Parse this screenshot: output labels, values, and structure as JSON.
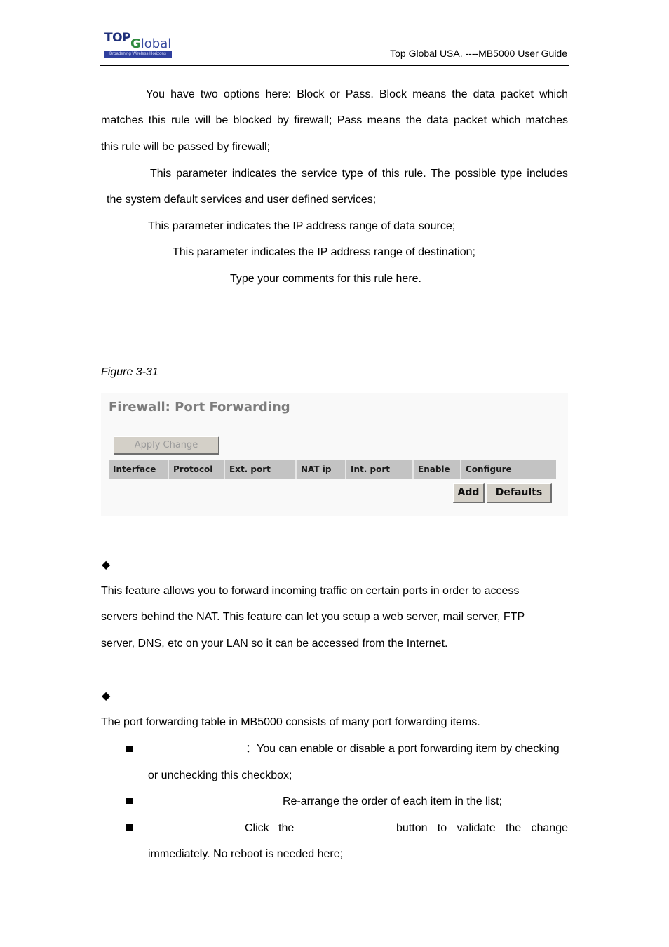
{
  "header": {
    "logo": {
      "top_text": "TOP",
      "global_g": "G",
      "global_rest": "lobal",
      "tagline": "Broadening Wireless Horizons"
    },
    "title": "Top Global USA. ----MB5000 User Guide"
  },
  "intro": {
    "action_line1": "You have two options here: Block or Pass. Block means the data packet which",
    "action_line2": "matches this rule will be blocked by firewall; Pass means the data packet which matches",
    "action_line3": "this rule will be passed by firewall;",
    "service_line1": "This parameter indicates the service type of this rule. The possible type includes",
    "service_line2": "the system default services and user defined services;",
    "source_line": "This parameter indicates the IP address range of data source;",
    "destination_line": "This parameter indicates the IP address range of destination;",
    "comment_line": "Type your comments for this rule here."
  },
  "figure": {
    "caption": "Figure 3-31",
    "title": "Firewall: Port Forwarding",
    "apply_button": "Apply Change",
    "table_headers": [
      "Interface",
      "Protocol",
      "Ext. port",
      "NAT ip",
      "Int. port",
      "Enable",
      "Configure"
    ],
    "add_button": "Add",
    "defaults_button": "Defaults"
  },
  "section1": {
    "bullet": "◆",
    "line1": "This feature allows you to forward incoming traffic on certain ports in order to access",
    "line2": "servers behind the NAT. This feature can let you setup a web server, mail server, FTP",
    "line3": "server, DNS, etc on your LAN so it can be accessed from the Internet."
  },
  "section2": {
    "bullet": "◆",
    "intro": "The port forwarding table in MB5000 consists of many port forwarding items.",
    "items": [
      {
        "line1": "：You can enable or disable a port forwarding item by checking",
        "line2": "or unchecking this checkbox;"
      },
      {
        "line1": "Re-arrange the order of each item in the list;"
      },
      {
        "part_a": "Click   the",
        "part_b": "button   to   validate   the   change",
        "line2": "immediately. No reboot is needed here;"
      }
    ]
  }
}
